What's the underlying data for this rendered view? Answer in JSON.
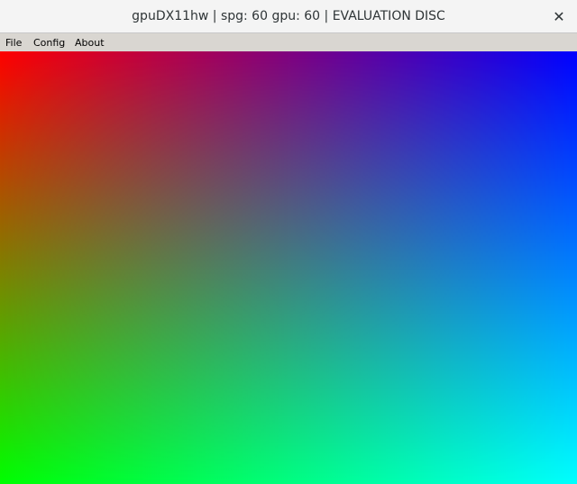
{
  "window": {
    "title": "gpuDX11hw | spg: 60 gpu: 60 | EVALUATION DISC",
    "close_glyph": "✕"
  },
  "menubar": {
    "items": [
      {
        "label": "File"
      },
      {
        "label": "Config"
      },
      {
        "label": "About"
      }
    ]
  },
  "canvas": {
    "corner_colors": {
      "top_left": "#ff0000",
      "top_right": "#0000ff",
      "bottom_left": "#00ff00",
      "bottom_right": "#00ffff"
    }
  }
}
